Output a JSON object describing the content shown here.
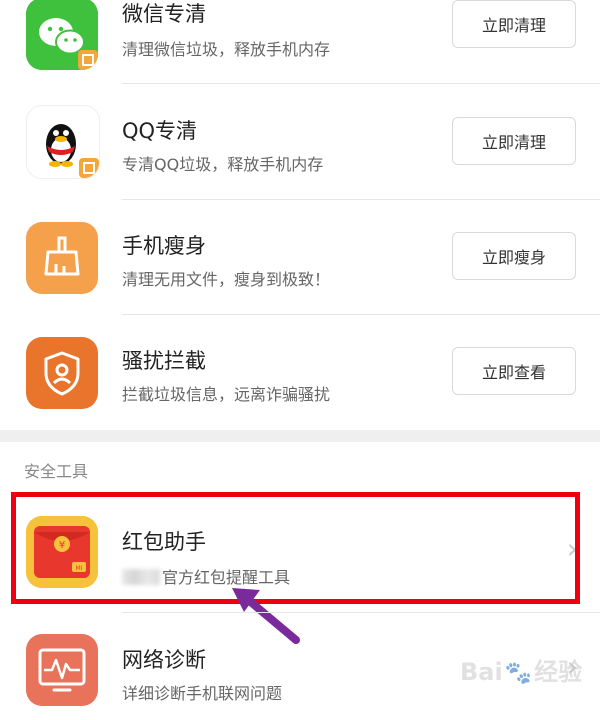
{
  "items": [
    {
      "title": "微信专清",
      "desc": "清理微信垃圾，释放手机内存",
      "button": "立即清理",
      "icon": "wechat-icon"
    },
    {
      "title": "QQ专清",
      "desc": "专清QQ垃圾，释放手机内存",
      "button": "立即清理",
      "icon": "qq-penguin-icon"
    },
    {
      "title": "手机瘦身",
      "desc": "清理无用文件，瘦身到极致！",
      "button": "立即瘦身",
      "icon": "broom-icon"
    },
    {
      "title": "骚扰拦截",
      "desc": "拦截垃圾信息，远离诈骗骚扰",
      "button": "立即查看",
      "icon": "shield-user-icon"
    }
  ],
  "safety_section": {
    "header": "安全工具",
    "items": [
      {
        "title": "红包助手",
        "desc": "官方红包提醒工具",
        "icon": "red-envelope-icon"
      },
      {
        "title": "网络诊断",
        "desc": "详细诊断手机联网问题",
        "icon": "network-monitor-icon"
      }
    ]
  },
  "chevron_glyph": "›",
  "watermark": {
    "text_left": "Bai",
    "text_right": "经验"
  },
  "colors": {
    "highlight": "#ee0011",
    "arrow": "#7b2a9c",
    "wechat_green": "#3fc13e",
    "orange": "#f5a04a",
    "deep_orange": "#e8752b",
    "network_coral": "#e8725a"
  }
}
